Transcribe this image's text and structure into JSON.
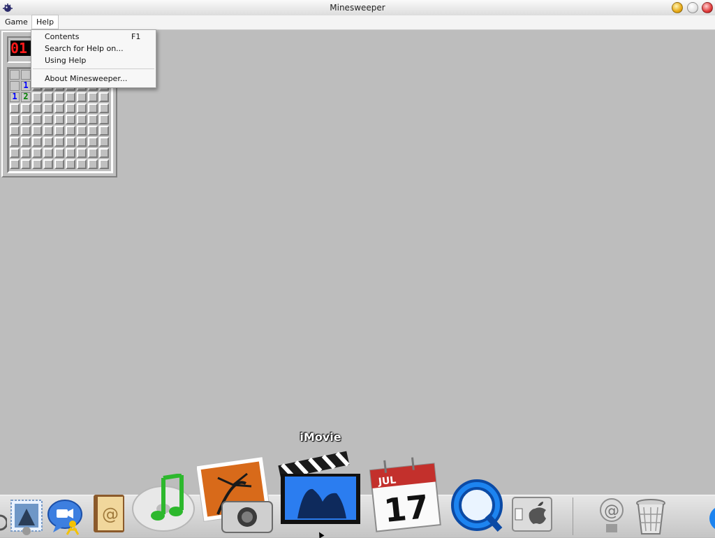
{
  "window": {
    "title": "Minesweeper"
  },
  "menubar": {
    "game": "Game",
    "help": "Help"
  },
  "help_menu": {
    "items": [
      {
        "label": "Contents",
        "shortcut": "F1"
      },
      {
        "label": "Search for Help on..."
      },
      {
        "label": "Using Help"
      },
      {
        "label": "About Minesweeper..."
      }
    ]
  },
  "minesweeper": {
    "mine_counter": "01",
    "grid": {
      "rows": 9,
      "cols": 9
    },
    "revealed": [
      {
        "row": 1,
        "col": 1,
        "value": "1",
        "color": "#0000ff"
      },
      {
        "row": 2,
        "col": 0,
        "value": "1",
        "color": "#0000ff"
      },
      {
        "row": 2,
        "col": 1,
        "value": "2",
        "color": "#008000"
      }
    ]
  },
  "dock": {
    "hover_label": "iMovie",
    "items": [
      "mail-icon",
      "ichat-icon",
      "address-book-icon",
      "itunes-icon",
      "iphoto-icon",
      "imovie-icon",
      "ical-icon",
      "quicktime-icon",
      "system-preferences-icon",
      "mail-drop-icon",
      "trash-icon"
    ],
    "ical_month": "JUL",
    "ical_day": "17"
  }
}
